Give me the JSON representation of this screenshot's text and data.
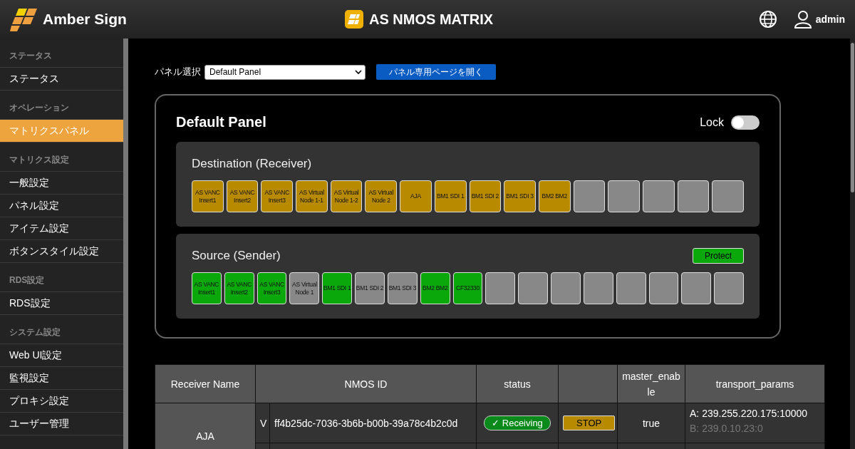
{
  "header": {
    "logo": "Amber Sign",
    "title": "AS NMOS MATRIX",
    "user": "admin"
  },
  "sidebar": {
    "sections": [
      {
        "heading": "ステータス",
        "items": [
          {
            "label": "ステータス",
            "selected": false
          }
        ]
      },
      {
        "heading": "オペレーション",
        "items": [
          {
            "label": "マトリクスパネル",
            "selected": true
          }
        ]
      },
      {
        "heading": "マトリクス設定",
        "items": [
          {
            "label": "一般設定",
            "selected": false
          },
          {
            "label": "パネル設定",
            "selected": false
          },
          {
            "label": "アイテム設定",
            "selected": false
          },
          {
            "label": "ボタンスタイル設定",
            "selected": false
          }
        ]
      },
      {
        "heading": "RDS設定",
        "items": [
          {
            "label": "RDS設定",
            "selected": false
          }
        ]
      },
      {
        "heading": "システム設定",
        "items": [
          {
            "label": "Web UI設定",
            "selected": false
          },
          {
            "label": "監視設定",
            "selected": false
          },
          {
            "label": "プロキシ設定",
            "selected": false
          },
          {
            "label": "ユーザー管理",
            "selected": false
          }
        ]
      }
    ]
  },
  "panel_select": {
    "label": "パネル選択",
    "value": "Default Panel",
    "open_button": "パネル専用ページを開く"
  },
  "panel": {
    "title": "Default Panel",
    "lock": {
      "label": "Lock",
      "on": false
    },
    "destination": {
      "title": "Destination (Receiver)",
      "buttons": [
        {
          "label": "AS VANC Insert1",
          "color": "#b88a00"
        },
        {
          "label": "AS VANC Insert2",
          "color": "#b88a00"
        },
        {
          "label": "AS VANC Insert3",
          "color": "#b88a00"
        },
        {
          "label": "AS Virtual Node 1-1",
          "color": "#b88a00"
        },
        {
          "label": "AS Virtual Node 1-2",
          "color": "#b88a00"
        },
        {
          "label": "AS Virtual Node 2",
          "color": "#b88a00"
        },
        {
          "label": "AJA",
          "color": "#b88a00"
        },
        {
          "label": "BM1 SDI 1",
          "color": "#b88a00"
        },
        {
          "label": "BM1 SDI 2",
          "color": "#b88a00"
        },
        {
          "label": "BM1 SDI 3",
          "color": "#b88a00"
        },
        {
          "label": "BM2 BM2",
          "color": "#b88a00"
        },
        {
          "color": "#888888"
        },
        {
          "color": "#888888"
        },
        {
          "color": "#888888"
        },
        {
          "color": "#888888"
        },
        {
          "color": "#888888"
        }
      ]
    },
    "source": {
      "title": "Source (Sender)",
      "protect_button": "Protect",
      "buttons": [
        {
          "label": "AS VANC Insert1",
          "color": "#0aa80a"
        },
        {
          "label": "AS VANC Insert2",
          "color": "#0aa80a"
        },
        {
          "label": "AS VANC Insert3",
          "color": "#0aa80a"
        },
        {
          "label": "AS Virtual Node 1",
          "color": "#888888"
        },
        {
          "label": "BM1 SDI 1",
          "color": "#0aa80a"
        },
        {
          "label": "BM1 SDI 2",
          "color": "#888888"
        },
        {
          "label": "BM1 SDI 3",
          "color": "#888888"
        },
        {
          "label": "BM2 BM2",
          "color": "#0aa80a"
        },
        {
          "label": "CF32330",
          "color": "#0aa80a"
        },
        {
          "color": "#888888"
        },
        {
          "color": "#888888"
        },
        {
          "color": "#888888"
        },
        {
          "color": "#888888"
        },
        {
          "color": "#888888"
        },
        {
          "color": "#888888"
        },
        {
          "color": "#888888"
        },
        {
          "color": "#888888"
        }
      ]
    }
  },
  "table": {
    "columns": [
      {
        "label": "Receiver Name"
      },
      {
        "label": "NMOS ID"
      },
      {
        "label": "status"
      },
      {},
      {
        "label": "master_enable"
      },
      {
        "label": "transport_params"
      }
    ],
    "rows": [
      {
        "receiver_name": "AJA",
        "type": "V",
        "nmos_id": "ff4b25dc-7036-3b6b-b00b-39a78c4b2c0d",
        "status": "✓ Receiving",
        "action": "STOP",
        "master_enable": "true",
        "transport_params": [
          {
            "text": "A: 239.255.220.175:10000",
            "disabled": false
          },
          {
            "text": "B: 239.0.10.23:0",
            "disabled": true
          }
        ]
      }
    ]
  }
}
